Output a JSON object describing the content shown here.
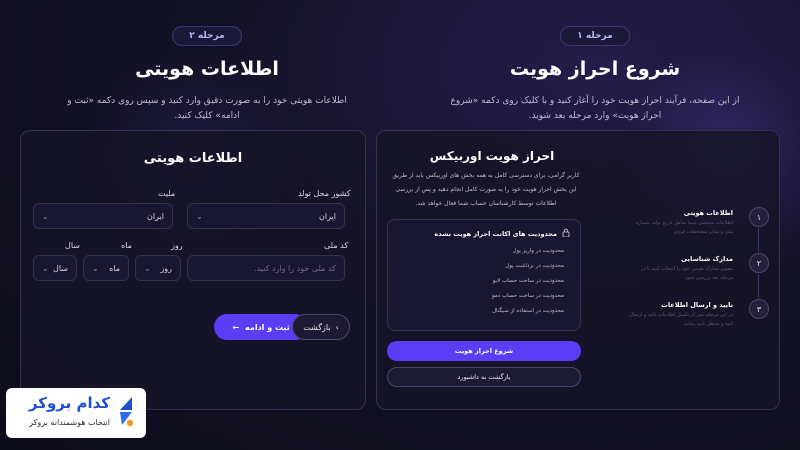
{
  "step1": {
    "badge": "مرحله ۱",
    "title": "شروع احراز هویت",
    "description": "از این صفحه، فرآیند احراز هویت خود را آغاز کنید و با کلیک روی دکمه «شروع احراز هویت» وارد مرحله بعد شوید."
  },
  "step2": {
    "badge": "مرحله ۲",
    "title": "اطلاعات هویتی",
    "description": "اطلاعات هویتی خود را به صورت دقیق وارد کنید و سپس روی دکمه «ثبت و ادامه» کلیک کنید."
  },
  "form": {
    "title": "اطلاعات هویتی",
    "nationality_label": "ملیت",
    "nationality_value": "ایران",
    "birth_country_label": "کشور محل تولد",
    "birth_country_value": "ایران",
    "national_code_label": "کد ملی",
    "national_code_placeholder": "کد ملی خود را وارد کنید.",
    "day_label": "روز",
    "day_value": "روز",
    "month_label": "ماه",
    "month_value": "ماه",
    "year_label": "سال",
    "year_value": "سال",
    "submit_label": "ثبت و ادامه",
    "back_label": "بازگشت"
  },
  "kyc": {
    "title": "احراز هویت اوربیکس",
    "description": "کاربر گرامی، برای دسترسی کامل به همه بخش های اوربیکس باید از طریق این بخش احراز هویت خود را به صورت کامل انجام دهید و پس از بررسی اطلاعات توسط کارشناسان حساب شما فعال خواهد شد.",
    "limits_title": "محدودیت های اکانت احراز هویت نشده",
    "limits": [
      "محدودیت در واریز پول",
      "محدودیت در برداشت پول",
      "محدودیت در ساخت حساب لایو",
      "محدودیت در ساخت حساب دمو",
      "محدودیت در استفاده از سیگنال"
    ],
    "start_label": "شروع احراز هویت",
    "dashboard_label": "بازگشت به داشبورد"
  },
  "steps": [
    {
      "num": "۱",
      "title": "اطلاعات هویتی",
      "desc": "اطلاعات شخصی شما شامل تاریخ تولد، شماره ملی و سایر مشخصات فردی"
    },
    {
      "num": "۲",
      "title": "مدارک شناسایی",
      "desc": "تصویر مدارک هویتی خود را انتخاب کنید تا در مرحله بعد بررسی شود"
    },
    {
      "num": "۳",
      "title": "تایید و ارسال اطلاعات",
      "desc": "در این مرحله پس از تکمیل اطلاعات تایید و ارسال کنید و منتظر تایید بمانید"
    }
  ],
  "logo": {
    "name": "کدام بروکر",
    "tagline": "انتخاب هوشمندانه بروکر"
  },
  "colors": {
    "accent": "#5b3df5",
    "brand_blue": "#1f4fd0",
    "logo_orange": "#f59a23"
  }
}
